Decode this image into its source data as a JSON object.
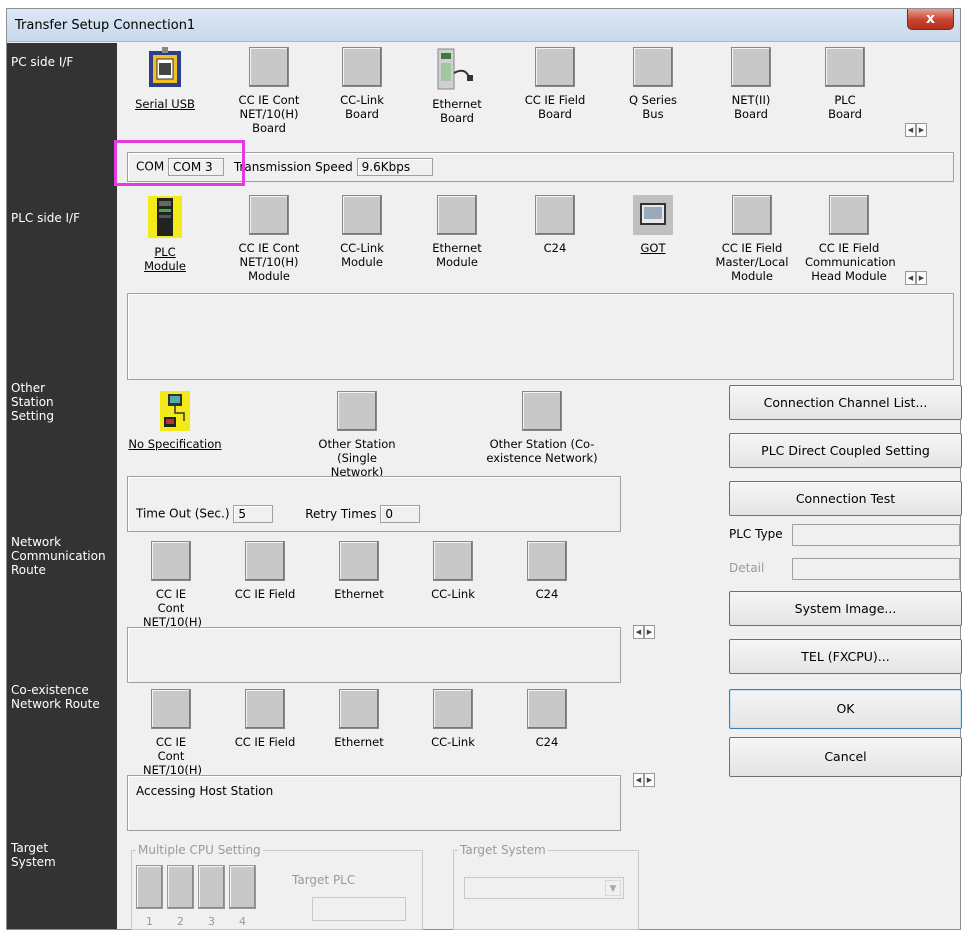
{
  "window": {
    "title": "Transfer Setup Connection1",
    "close_label": "x"
  },
  "sidebar": {
    "pc_side": "PC side I/F",
    "plc_side": "PLC side I/F",
    "other_station": "Other Station Setting",
    "network_route": "Network Communication Route",
    "coexistence_route": "Co-existence Network Route",
    "target_system": "Target System"
  },
  "pc_side_items": [
    {
      "label": "Serial USB",
      "icon": "serial-usb-icon"
    },
    {
      "label": "CC IE Cont NET/10(H) Board",
      "icon": "blank-tile"
    },
    {
      "label": "CC-Link Board",
      "icon": "blank-tile"
    },
    {
      "label": "Ethernet Board",
      "icon": "ethernet-icon"
    },
    {
      "label": "CC IE Field Board",
      "icon": "blank-tile"
    },
    {
      "label": "Q Series Bus",
      "icon": "blank-tile"
    },
    {
      "label": "NET(II) Board",
      "icon": "blank-tile"
    },
    {
      "label": "PLC Board",
      "icon": "blank-tile"
    }
  ],
  "pc_side_info": {
    "com_label": "COM",
    "com_value": "COM 3",
    "speed_label": "Transmission Speed",
    "speed_value": "9.6Kbps"
  },
  "plc_side_items": [
    {
      "label": "PLC Module",
      "icon": "plc-module-icon"
    },
    {
      "label": "CC IE Cont NET/10(H) Module",
      "icon": "blank-tile"
    },
    {
      "label": "CC-Link Module",
      "icon": "blank-tile"
    },
    {
      "label": "Ethernet Module",
      "icon": "blank-tile"
    },
    {
      "label": "C24",
      "icon": "blank-tile"
    },
    {
      "label": "GOT",
      "icon": "got-icon"
    },
    {
      "label": "CC IE Field Master/Local Module",
      "icon": "blank-tile"
    },
    {
      "label": "CC IE Field Communication Head Module",
      "icon": "blank-tile"
    }
  ],
  "other_station_items": [
    {
      "label": "No Specification",
      "icon": "no-spec-icon"
    },
    {
      "label": "Other Station (Single Network)",
      "icon": "blank-tile"
    },
    {
      "label": "Other Station (Co-existence Network)",
      "icon": "blank-tile"
    }
  ],
  "other_station_info": {
    "timeout_label": "Time Out (Sec.)",
    "timeout_value": "5",
    "retry_label": "Retry Times",
    "retry_value": "0"
  },
  "network_route_items": [
    {
      "label": "CC IE Cont NET/10(H)"
    },
    {
      "label": "CC IE Field"
    },
    {
      "label": "Ethernet"
    },
    {
      "label": "CC-Link"
    },
    {
      "label": "C24"
    }
  ],
  "coexistence_items": [
    {
      "label": "CC IE Cont NET/10(H)"
    },
    {
      "label": "CC IE Field"
    },
    {
      "label": "Ethernet"
    },
    {
      "label": "CC-Link"
    },
    {
      "label": "C24"
    }
  ],
  "coexistence_info": "Accessing Host Station",
  "target": {
    "multiple_cpu_label": "Multiple CPU Setting",
    "target_plc_label": "Target PLC",
    "cpu_numbers": [
      "1",
      "2",
      "3",
      "4"
    ],
    "target_system_label": "Target System"
  },
  "right_panel": {
    "channel_list": "Connection Channel List...",
    "direct_coupled": "PLC Direct Coupled Setting",
    "connection_test": "Connection Test",
    "plc_type_label": "PLC Type",
    "detail_label": "Detail",
    "system_image": "System Image...",
    "tel": "TEL (FXCPU)...",
    "ok": "OK",
    "cancel": "Cancel"
  },
  "colors": {
    "sidebar_bg": "#333333",
    "dialog_bg": "#f0f0f0",
    "highlight": "#e43be1",
    "tile_gray": "#c8c8c8"
  }
}
